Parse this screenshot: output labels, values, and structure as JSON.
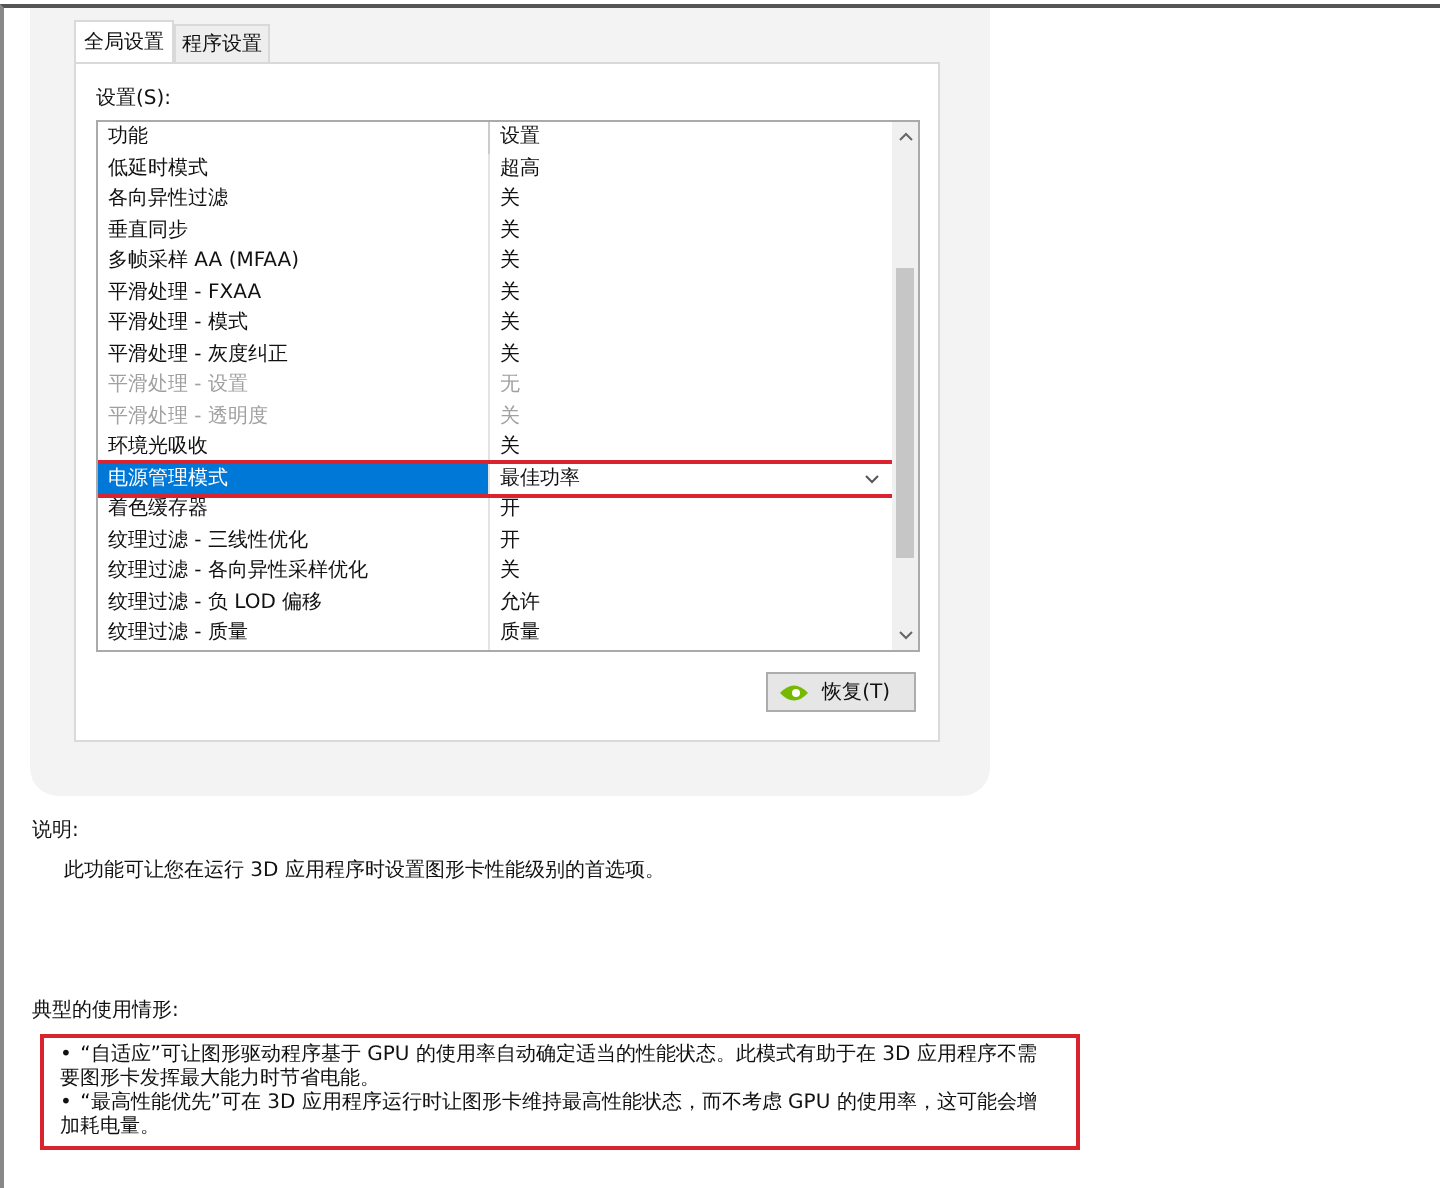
{
  "tabs": [
    {
      "label": "全局设置",
      "selected": true
    },
    {
      "label": "程序设置",
      "selected": false
    }
  ],
  "settings_label": "设置(S):",
  "table": {
    "columns": [
      "功能",
      "设置"
    ],
    "rows": [
      {
        "feature": "低延时模式",
        "value": "超高",
        "disabled": false,
        "selected": false,
        "highlighted": false
      },
      {
        "feature": "各向异性过滤",
        "value": "关",
        "disabled": false,
        "selected": false,
        "highlighted": false
      },
      {
        "feature": "垂直同步",
        "value": "关",
        "disabled": false,
        "selected": false,
        "highlighted": false
      },
      {
        "feature": "多帧采样 AA (MFAA)",
        "value": "关",
        "disabled": false,
        "selected": false,
        "highlighted": false
      },
      {
        "feature": "平滑处理 - FXAA",
        "value": "关",
        "disabled": false,
        "selected": false,
        "highlighted": false
      },
      {
        "feature": "平滑处理 - 模式",
        "value": "关",
        "disabled": false,
        "selected": false,
        "highlighted": false
      },
      {
        "feature": "平滑处理 - 灰度纠正",
        "value": "关",
        "disabled": false,
        "selected": false,
        "highlighted": false
      },
      {
        "feature": "平滑处理 - 设置",
        "value": "无",
        "disabled": true,
        "selected": false,
        "highlighted": false
      },
      {
        "feature": "平滑处理 - 透明度",
        "value": "关",
        "disabled": true,
        "selected": false,
        "highlighted": false
      },
      {
        "feature": "环境光吸收",
        "value": "关",
        "disabled": false,
        "selected": false,
        "highlighted": false
      },
      {
        "feature": "电源管理模式",
        "value": "最佳功率",
        "disabled": false,
        "selected": true,
        "highlighted": true
      },
      {
        "feature": "着色缓存器",
        "value": "开",
        "disabled": false,
        "selected": false,
        "highlighted": false
      },
      {
        "feature": "纹理过滤 - 三线性优化",
        "value": "开",
        "disabled": false,
        "selected": false,
        "highlighted": false
      },
      {
        "feature": "纹理过滤 - 各向异性采样优化",
        "value": "关",
        "disabled": false,
        "selected": false,
        "highlighted": false
      },
      {
        "feature": "纹理过滤 - 负 LOD 偏移",
        "value": "允许",
        "disabled": false,
        "selected": false,
        "highlighted": false
      },
      {
        "feature": "纹理过滤 - 质量",
        "value": "质量",
        "disabled": false,
        "selected": false,
        "highlighted": false
      }
    ]
  },
  "restore_button": "恢复(T)",
  "description": {
    "heading": "说明:",
    "text": "此功能可让您在运行 3D 应用程序时设置图形卡性能级别的首选项。"
  },
  "usage": {
    "heading": "典型的使用情形:",
    "highlighted": true,
    "bullet": "•",
    "items": [
      "“自适应”可让图形驱动程序基于 GPU 的使用率自动确定适当的性能状态。此模式有助于在 3D 应用程序不需要图形卡发挥最大能力时节省电能。",
      "“最高性能优先”可在 3D 应用程序运行时让图形卡维持最高性能状态，而不考虑 GPU 的使用率，这可能会增加耗电量。"
    ]
  }
}
